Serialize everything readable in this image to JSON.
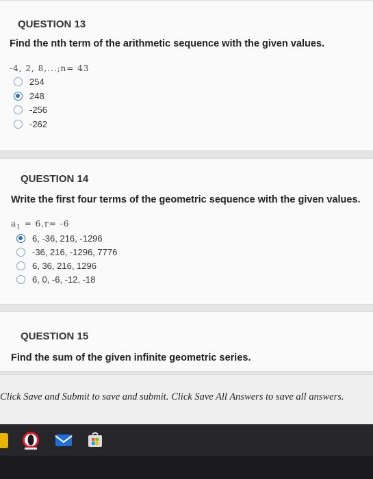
{
  "q13": {
    "title": "QUESTION 13",
    "prompt": "Find the nth term of the arithmetic sequence with the given values.",
    "given": "-4, 2, 8,...;n= 43",
    "options": [
      "254",
      "248",
      "-256",
      "-262"
    ],
    "selected_index": 1
  },
  "q14": {
    "title": "QUESTION 14",
    "prompt": "Write the first four terms of the geometric sequence with the given values.",
    "given_sub": "a",
    "given_subscript": "1",
    "given_rest": "= 6,r= -6",
    "options": [
      "6, -36, 216, -1296",
      "-36, 216, -1296, 7776",
      "6, 36, 216, 1296",
      "6, 0, -6, -12, -18"
    ],
    "selected_index": 0
  },
  "q15": {
    "title": "QUESTION 15",
    "prompt": "Find the sum of the given infinite geometric series."
  },
  "footer": {
    "text": "Click Save and Submit to save and submit. Click Save All Answers to save all answers."
  },
  "taskbar": {
    "icons": [
      "opera-icon",
      "mail-icon",
      "store-icon"
    ]
  },
  "colors": {
    "radio_selected": "#2f6fbf",
    "taskbar": "#1b1b1f",
    "accent_yellow": "#e8b400"
  }
}
